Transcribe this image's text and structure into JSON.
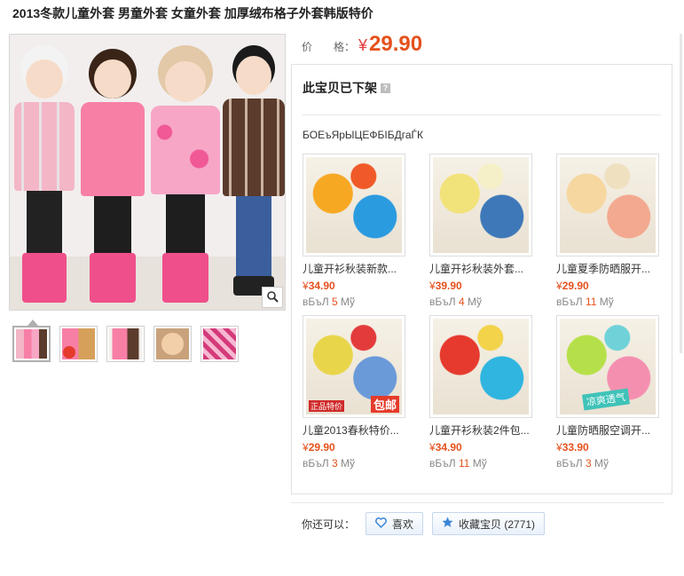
{
  "product": {
    "title": "2013冬款儿童外套 男童外套 女童外套 加厚绒布格子外套韩版特价",
    "price_label": "价　　格：",
    "price_currency": "¥",
    "price_value": "29.90"
  },
  "panel": {
    "title": "此宝贝已下架",
    "help_glyph": "?",
    "subtitle": "БОЕъЯрЫЦЕФБІБДгаЃК"
  },
  "recommendations": [
    {
      "name": "儿童开衫秋装新款...",
      "currency": "¥",
      "price": "34.90",
      "sold_prefix": "вБъЛ",
      "sold_count": "5",
      "sold_suffix": "Мў",
      "colors": [
        "#f7a823",
        "#2b9be0",
        "#f05a28"
      ]
    },
    {
      "name": "儿童开衫秋装外套...",
      "currency": "¥",
      "price": "39.90",
      "sold_prefix": "вБъЛ",
      "sold_count": "4",
      "sold_suffix": "Мў",
      "colors": [
        "#f2e27a",
        "#3e78b8",
        "#f5f0c8"
      ]
    },
    {
      "name": "儿童夏季防晒服开...",
      "currency": "¥",
      "price": "29.90",
      "sold_prefix": "вБъЛ",
      "sold_count": "11",
      "sold_suffix": "Мў",
      "colors": [
        "#f6d7a0",
        "#f3a98f",
        "#efe0c0"
      ]
    },
    {
      "name": "儿童2013春秋特价...",
      "currency": "¥",
      "price": "29.90",
      "sold_prefix": "вБъЛ",
      "sold_count": "3",
      "sold_suffix": "Мў",
      "colors": [
        "#e9d54a",
        "#6a9ad8",
        "#e33b3b"
      ]
    },
    {
      "name": "儿童开衫秋装2件包...",
      "currency": "¥",
      "price": "34.90",
      "sold_prefix": "вБъЛ",
      "sold_count": "11",
      "sold_suffix": "Мў",
      "colors": [
        "#e63a2e",
        "#2fb5e0",
        "#f3d34a"
      ]
    },
    {
      "name": "儿童防晒服空调开...",
      "currency": "¥",
      "price": "33.90",
      "sold_prefix": "вБъЛ",
      "sold_count": "3",
      "sold_suffix": "Мў",
      "colors": [
        "#b6e04a",
        "#f58fb0",
        "#6fd2d8"
      ]
    }
  ],
  "promo_badge_text": "包邮",
  "promo_small_text": "正品特价",
  "promo_tag_text": "凉爽透气",
  "actions": {
    "label": "你还可以：",
    "like_label": "喜欢",
    "favorite_label": "收藏宝贝 (2771)"
  },
  "icons": {
    "zoom": "magnifier-icon",
    "like": "heart-icon",
    "favorite": "star-icon"
  },
  "theme": {
    "price_color": "#e5511d",
    "button_border": "#c6d6ec"
  }
}
